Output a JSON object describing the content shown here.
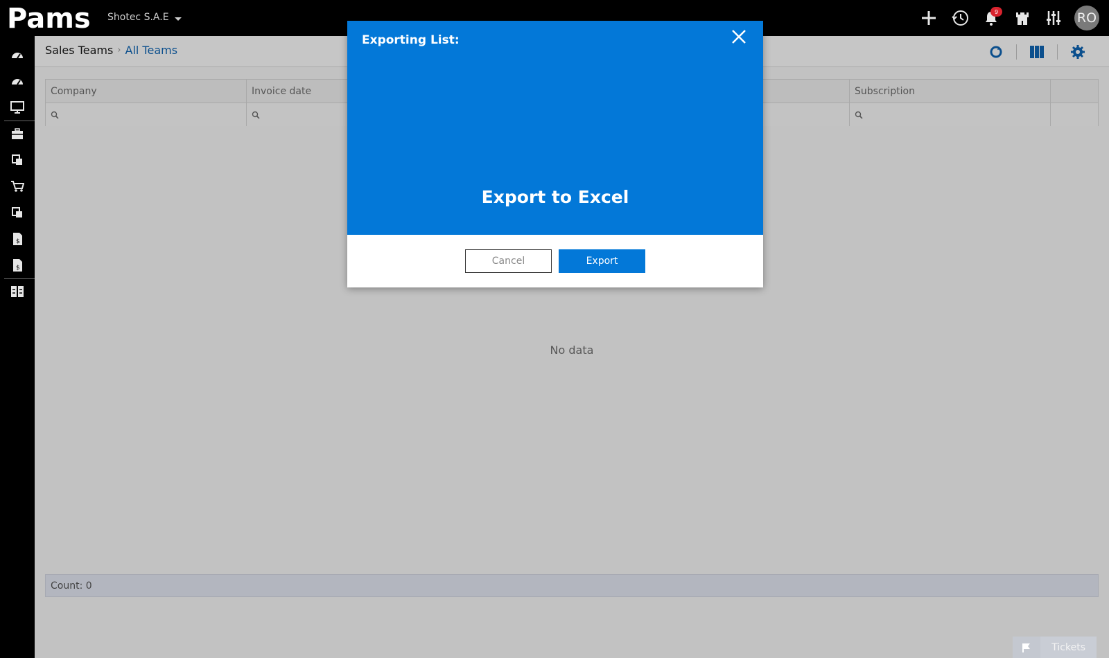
{
  "topbar": {
    "logo_text": "Pams",
    "company": "Shotec S.A.E",
    "notifications_count": "9",
    "avatar_initials": "RO"
  },
  "breadcrumb": {
    "root": "Sales Teams",
    "current": "All Teams"
  },
  "table": {
    "columns": [
      "Company",
      "Invoice date",
      "",
      "",
      "Subscription",
      ""
    ],
    "empty_message": "No data",
    "count_label": "Count: 0"
  },
  "modal": {
    "title": "Exporting List:",
    "heading": "Export to Excel",
    "cancel_label": "Cancel",
    "export_label": "Export"
  },
  "tickets": {
    "label": "Tickets"
  },
  "colors": {
    "accent": "#0378d8",
    "topbar": "#000000",
    "overlay_bg": "#c2c2c2",
    "badge": "#d9232e",
    "link": "#0b4f8d"
  }
}
